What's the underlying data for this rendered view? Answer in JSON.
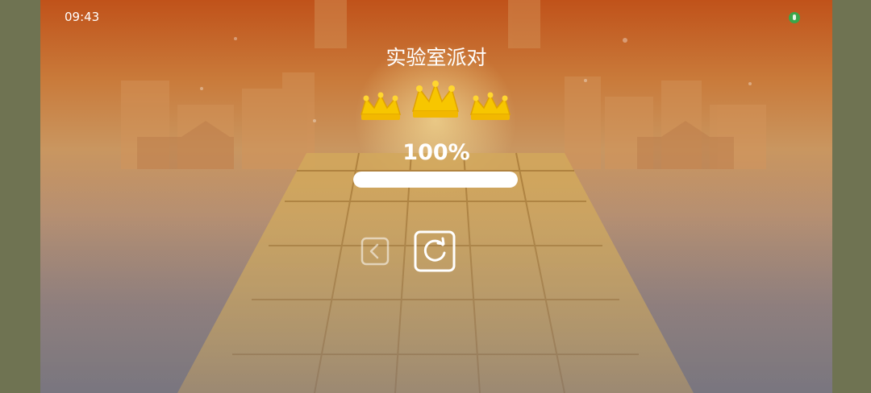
{
  "status_bar": {
    "time": "09:43",
    "mic_icon": "mic-active-icon",
    "mic_color": "#3aa64a"
  },
  "level": {
    "title": "实验室派对"
  },
  "result": {
    "crowns_earned": 3,
    "crowns_total": 3,
    "crown_icon": "crown-icon",
    "crown_color": "#f7c600",
    "percent_text": "100%",
    "progress": 1.0
  },
  "controls": {
    "back": {
      "icon": "chevron-left-icon"
    },
    "restart": {
      "icon": "restart-icon"
    }
  },
  "colors": {
    "sky_top": "#c0521a",
    "floor": "#d2a85c",
    "ui_white": "#ffffff"
  }
}
